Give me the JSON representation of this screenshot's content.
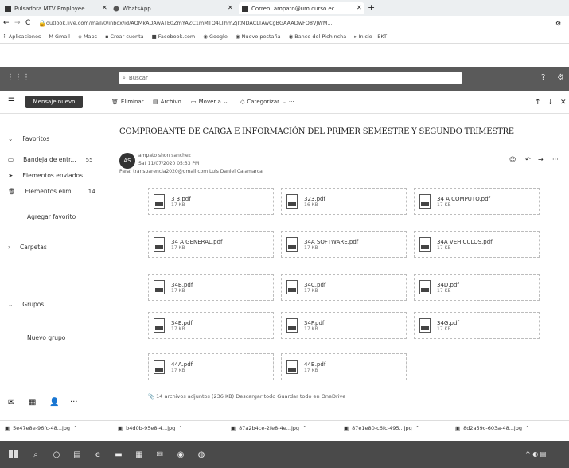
{
  "browser": {
    "tabs": [
      {
        "label": "Pulsadora MTV Employee",
        "active": false
      },
      {
        "label": "WhatsApp",
        "active": false
      },
      {
        "label": "Correo: ampato@um.curso.ec",
        "active": true
      }
    ],
    "url": "outlook.live.com/mail/0/inbox/id/AQMkADAwATE0ZmYAZC1mMTQ4LThmZjItMDACLTAwCgBGAAADwFQ8VJWM...",
    "bookmarks": [
      "Aplicaciones",
      "Gmail",
      "Maps",
      "Crear cuenta",
      "Facebook.com",
      "Google",
      "Nuevo pestaña",
      "Banco del Pichincha",
      "Inicio - EKT"
    ]
  },
  "outlook": {
    "search_placeholder": "Buscar",
    "new_message": "Mensaje nuevo",
    "commands": [
      "Eliminar",
      "Archivo",
      "Mover a",
      "Categorizar"
    ],
    "nav": [
      {
        "label": "Favoritos",
        "count": ""
      },
      {
        "label": "Bandeja de entr...",
        "count": "55"
      },
      {
        "label": "Elementos enviados",
        "count": ""
      },
      {
        "label": "Elementos elimi...",
        "count": "14"
      },
      {
        "label": "Agregar favorito",
        "count": ""
      },
      {
        "label": "Carpetas",
        "count": ""
      },
      {
        "label": "Grupos",
        "count": ""
      },
      {
        "label": "Nuevo grupo",
        "count": ""
      }
    ]
  },
  "email": {
    "subject": "COMPROBANTE DE CARGA E INFORMACIÓN DEL PRIMER SEMESTRE Y SEGUNDO TRIMESTRE",
    "avatar": "AS",
    "sender": "ampato shon sanchez",
    "date": "Sat 11/07/2020 05:33 PM",
    "to": "Para: transparencia2020@gmail.com Luis Daniel Cajamarca",
    "attachments": [
      {
        "name": "3 3.pdf",
        "size": "17 KB"
      },
      {
        "name": "323.pdf",
        "size": "16 KB"
      },
      {
        "name": "34 A COMPUTO.pdf",
        "size": "17 KB"
      },
      {
        "name": "34 A GENERAL.pdf",
        "size": "17 KB"
      },
      {
        "name": "34A SOFTWARE.pdf",
        "size": "17 KB"
      },
      {
        "name": "34A VEHICULOS.pdf",
        "size": "17 KB"
      },
      {
        "name": "34B.pdf",
        "size": "17 KB"
      },
      {
        "name": "34C.pdf",
        "size": "17 KB"
      },
      {
        "name": "34D.pdf",
        "size": "17 KB"
      },
      {
        "name": "34E.pdf",
        "size": "17 KB"
      },
      {
        "name": "34F.pdf",
        "size": "17 KB"
      },
      {
        "name": "34G.pdf",
        "size": "17 KB"
      },
      {
        "name": "44A.pdf",
        "size": "17 KB"
      },
      {
        "name": "44B.pdf",
        "size": "17 KB"
      }
    ],
    "footer": "14 archivos adjuntos (236 KB)   Descargar todo   Guardar todo en OneDrive"
  },
  "downloads": [
    "5e47e8e-96fc-48...jpg",
    "b4d0b-95e8-4...jpg",
    "87a2b4ce-2fe8-4e...jpg",
    "87e1e80-c6fc-495...jpg",
    "8d2a59c-603a-48...jpg"
  ],
  "colors": {
    "header": "#5a5a5a",
    "taskbar": "#4a4a4a",
    "new_message_bg": "#3a3a3a"
  }
}
